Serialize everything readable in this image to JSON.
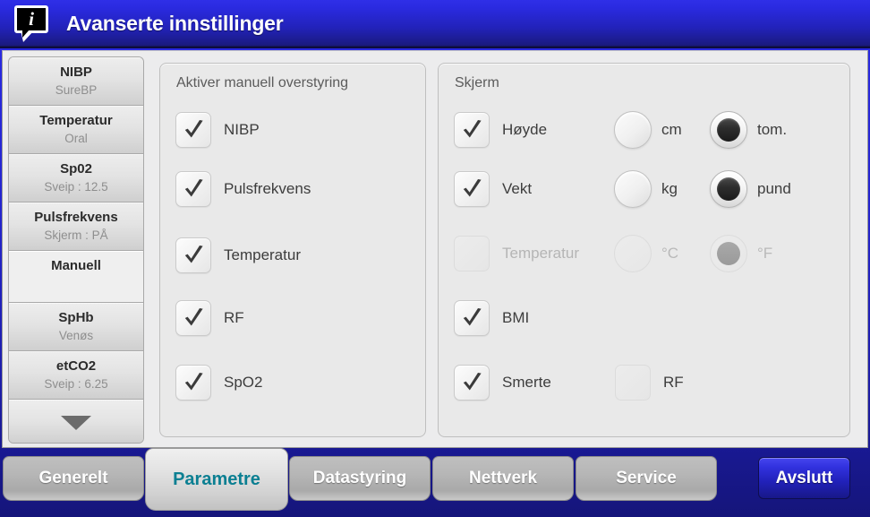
{
  "window": {
    "title": "Avanserte innstillinger",
    "info_icon": "info-bubble-icon",
    "titlebar_color": "#2424cf",
    "accent_color": "#0b7f92",
    "panel_color": "#e9e9e9"
  },
  "sidebar": {
    "items": [
      {
        "title": "NIBP",
        "subtitle": "SureBP",
        "selected": false
      },
      {
        "title": "Temperatur",
        "subtitle": "Oral",
        "selected": false
      },
      {
        "title": "Sp02",
        "subtitle": "Sveip : 12.5",
        "selected": false
      },
      {
        "title": "Pulsfrekvens",
        "subtitle": "Skjerm : PÅ",
        "selected": false
      },
      {
        "title": "Manuell",
        "subtitle": "",
        "selected": true
      },
      {
        "title": "SpHb",
        "subtitle": "Venøs",
        "selected": false
      },
      {
        "title": "etCO2",
        "subtitle": "Sveip : 6.25",
        "selected": false
      }
    ],
    "scroll_down_label": "",
    "scroll_down_icon": "caret-down-icon"
  },
  "override_panel": {
    "title": "Aktiver manuell overstyring",
    "rows": [
      {
        "label": "NIBP",
        "checked": true,
        "enabled": true
      },
      {
        "label": "Pulsfrekvens",
        "checked": true,
        "enabled": true
      },
      {
        "label": "Temperatur",
        "checked": true,
        "enabled": true
      },
      {
        "label": "RF",
        "checked": true,
        "enabled": true
      },
      {
        "label": "SpO2",
        "checked": true,
        "enabled": true
      }
    ]
  },
  "display_panel": {
    "title": "Skjerm",
    "rows": [
      {
        "label": "Høyde",
        "checked": true,
        "enabled": true,
        "unit_a": "cm",
        "unit_a_selected": false,
        "unit_b": "tom.",
        "unit_b_selected": true
      },
      {
        "label": "Vekt",
        "checked": true,
        "enabled": true,
        "unit_a": "kg",
        "unit_a_selected": false,
        "unit_b": "pund",
        "unit_b_selected": true
      },
      {
        "label": "Temperatur",
        "checked": false,
        "enabled": false,
        "unit_a": "°C",
        "unit_a_selected": false,
        "unit_b": "°F",
        "unit_b_selected": true
      },
      {
        "label": "BMI",
        "checked": true,
        "enabled": true
      },
      {
        "label": "Smerte",
        "checked": true,
        "enabled": true,
        "extra_label": "RF",
        "extra_checked": false,
        "extra_enabled": true
      }
    ]
  },
  "tabs": [
    {
      "label": "Generelt",
      "active": false
    },
    {
      "label": "Parametre",
      "active": true
    },
    {
      "label": "Datastyring",
      "active": false
    },
    {
      "label": "Nettverk",
      "active": false
    },
    {
      "label": "Service",
      "active": false
    }
  ],
  "exit_button": {
    "label": "Avslutt"
  }
}
